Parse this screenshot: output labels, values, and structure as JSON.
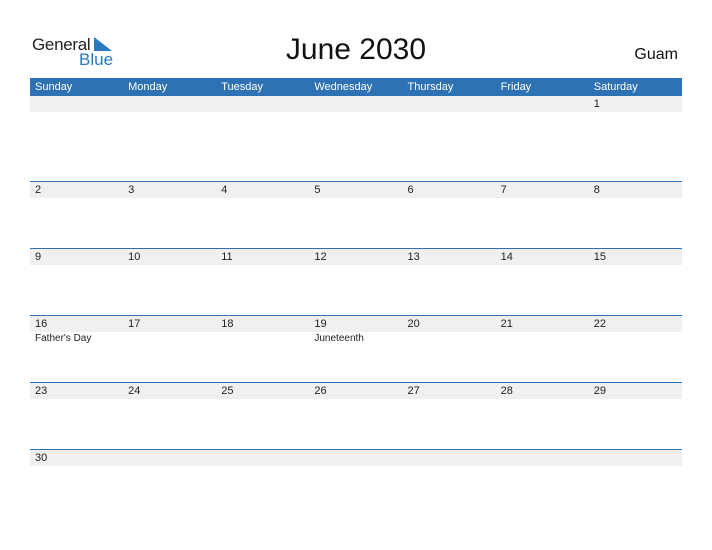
{
  "logo": {
    "general": "General",
    "blue": "Blue"
  },
  "title": "June 2030",
  "region": "Guam",
  "colors": {
    "accent": "#2e72b4",
    "band": "#f0f0f0"
  },
  "weekdays": [
    "Sunday",
    "Monday",
    "Tuesday",
    "Wednesday",
    "Thursday",
    "Friday",
    "Saturday"
  ],
  "weeks": [
    {
      "days": [
        "",
        "",
        "",
        "",
        "",
        "",
        "1"
      ],
      "events": [
        "",
        "",
        "",
        "",
        "",
        "",
        ""
      ]
    },
    {
      "days": [
        "2",
        "3",
        "4",
        "5",
        "6",
        "7",
        "8"
      ],
      "events": [
        "",
        "",
        "",
        "",
        "",
        "",
        ""
      ]
    },
    {
      "days": [
        "9",
        "10",
        "11",
        "12",
        "13",
        "14",
        "15"
      ],
      "events": [
        "",
        "",
        "",
        "",
        "",
        "",
        ""
      ]
    },
    {
      "days": [
        "16",
        "17",
        "18",
        "19",
        "20",
        "21",
        "22"
      ],
      "events": [
        "Father's Day",
        "",
        "",
        "Juneteenth",
        "",
        "",
        ""
      ]
    },
    {
      "days": [
        "23",
        "24",
        "25",
        "26",
        "27",
        "28",
        "29"
      ],
      "events": [
        "",
        "",
        "",
        "",
        "",
        "",
        ""
      ]
    },
    {
      "days": [
        "30",
        "",
        "",
        "",
        "",
        "",
        ""
      ],
      "events": [
        "",
        "",
        "",
        "",
        "",
        "",
        ""
      ]
    }
  ]
}
